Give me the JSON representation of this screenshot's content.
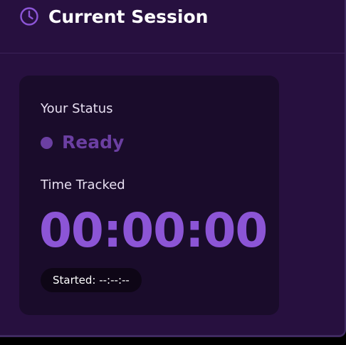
{
  "header": {
    "title": "Current Session",
    "icon": "clock-icon"
  },
  "session": {
    "status_label": "Your Status",
    "status_value": "Ready",
    "time_label": "Time Tracked",
    "timer": "00:00:00",
    "started_label": "Started:",
    "started_value": "--:--:--"
  },
  "colors": {
    "background": "#27103f",
    "card": "#1a0c2b",
    "accent": "#8c55d6",
    "status": "#6b3fa2"
  }
}
